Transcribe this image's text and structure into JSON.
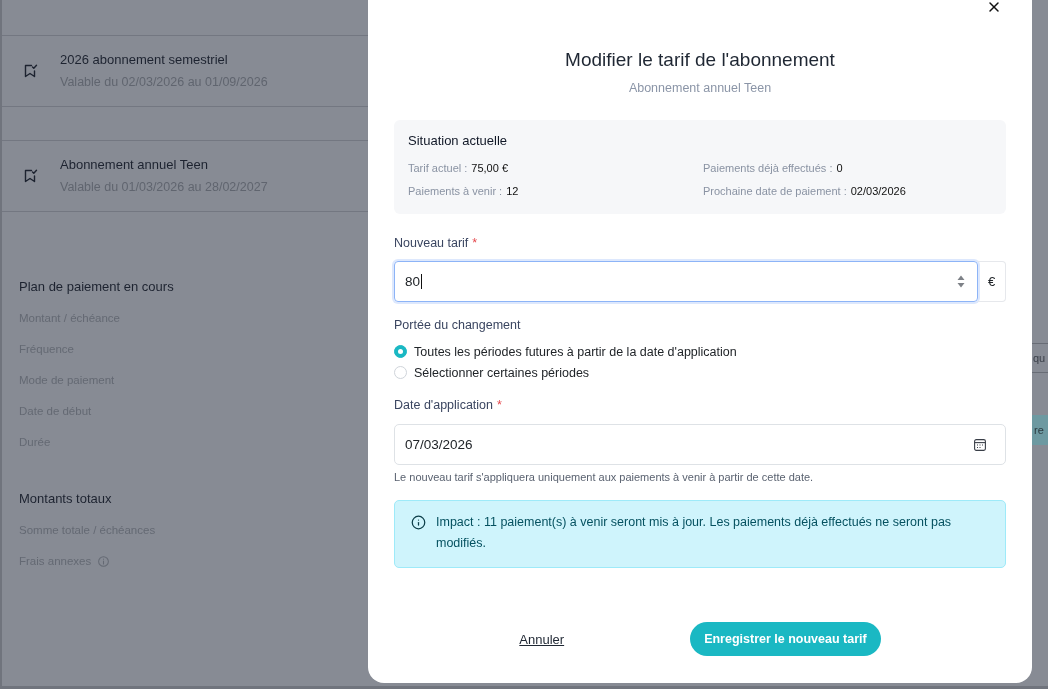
{
  "background": {
    "subscriptions": [
      {
        "title": "2026 abonnement semestriel",
        "validity": "Valable du 02/03/2026 au 01/09/2026"
      },
      {
        "title": "Abonnement annuel Teen",
        "validity": "Valable du 01/03/2026 au 28/02/2027"
      }
    ],
    "payment_plan": {
      "heading": "Plan de paiement en cours",
      "fields": [
        {
          "label": "Montant / échéance",
          "has_info": false
        },
        {
          "label": "Fréquence",
          "has_info": false
        },
        {
          "label": "Mode de paiement",
          "has_info": false
        },
        {
          "label": "Date de début",
          "has_info": false
        },
        {
          "label": "Durée",
          "has_info": false
        }
      ]
    },
    "totals": {
      "heading": "Montants totaux",
      "fields": [
        {
          "label": "Somme totale / échéances",
          "has_info": false
        },
        {
          "label": "Frais annexes",
          "has_info": true
        }
      ]
    },
    "right_edge": {
      "field_value": "qu",
      "button_label": "re"
    }
  },
  "modal": {
    "title": "Modifier le tarif de l'abonnement",
    "subtitle": "Abonnement annuel Teen",
    "current_situation": {
      "heading": "Situation actuelle",
      "items": [
        {
          "label": "Tarif actuel :",
          "value": "75,00 €"
        },
        {
          "label": "Paiements déjà effectués :",
          "value": "0"
        },
        {
          "label": "Paiements à venir :",
          "value": "12"
        },
        {
          "label": "Prochaine date de paiement :",
          "value": "02/03/2026"
        }
      ]
    },
    "new_rate": {
      "label": "Nouveau tarif",
      "required_mark": "*",
      "value": "80",
      "unit": "€",
      "focused": true
    },
    "scope": {
      "label": "Portée du changement",
      "options": [
        {
          "label": "Toutes les périodes futures à partir de la date d'application",
          "selected": true
        },
        {
          "label": "Sélectionner certaines périodes",
          "selected": false
        }
      ]
    },
    "application_date": {
      "label": "Date d'application",
      "required_mark": "*",
      "value": "07/03/2026",
      "help": "Le nouveau tarif s'appliquera uniquement aux paiements à venir à partir de cette date."
    },
    "impact": "Impact : 11 paiement(s) à venir seront mis à jour. Les paiements déjà effectués ne seront pas modifiés.",
    "buttons": {
      "cancel": "Annuler",
      "save": "Enregistrer le nouveau tarif"
    }
  }
}
